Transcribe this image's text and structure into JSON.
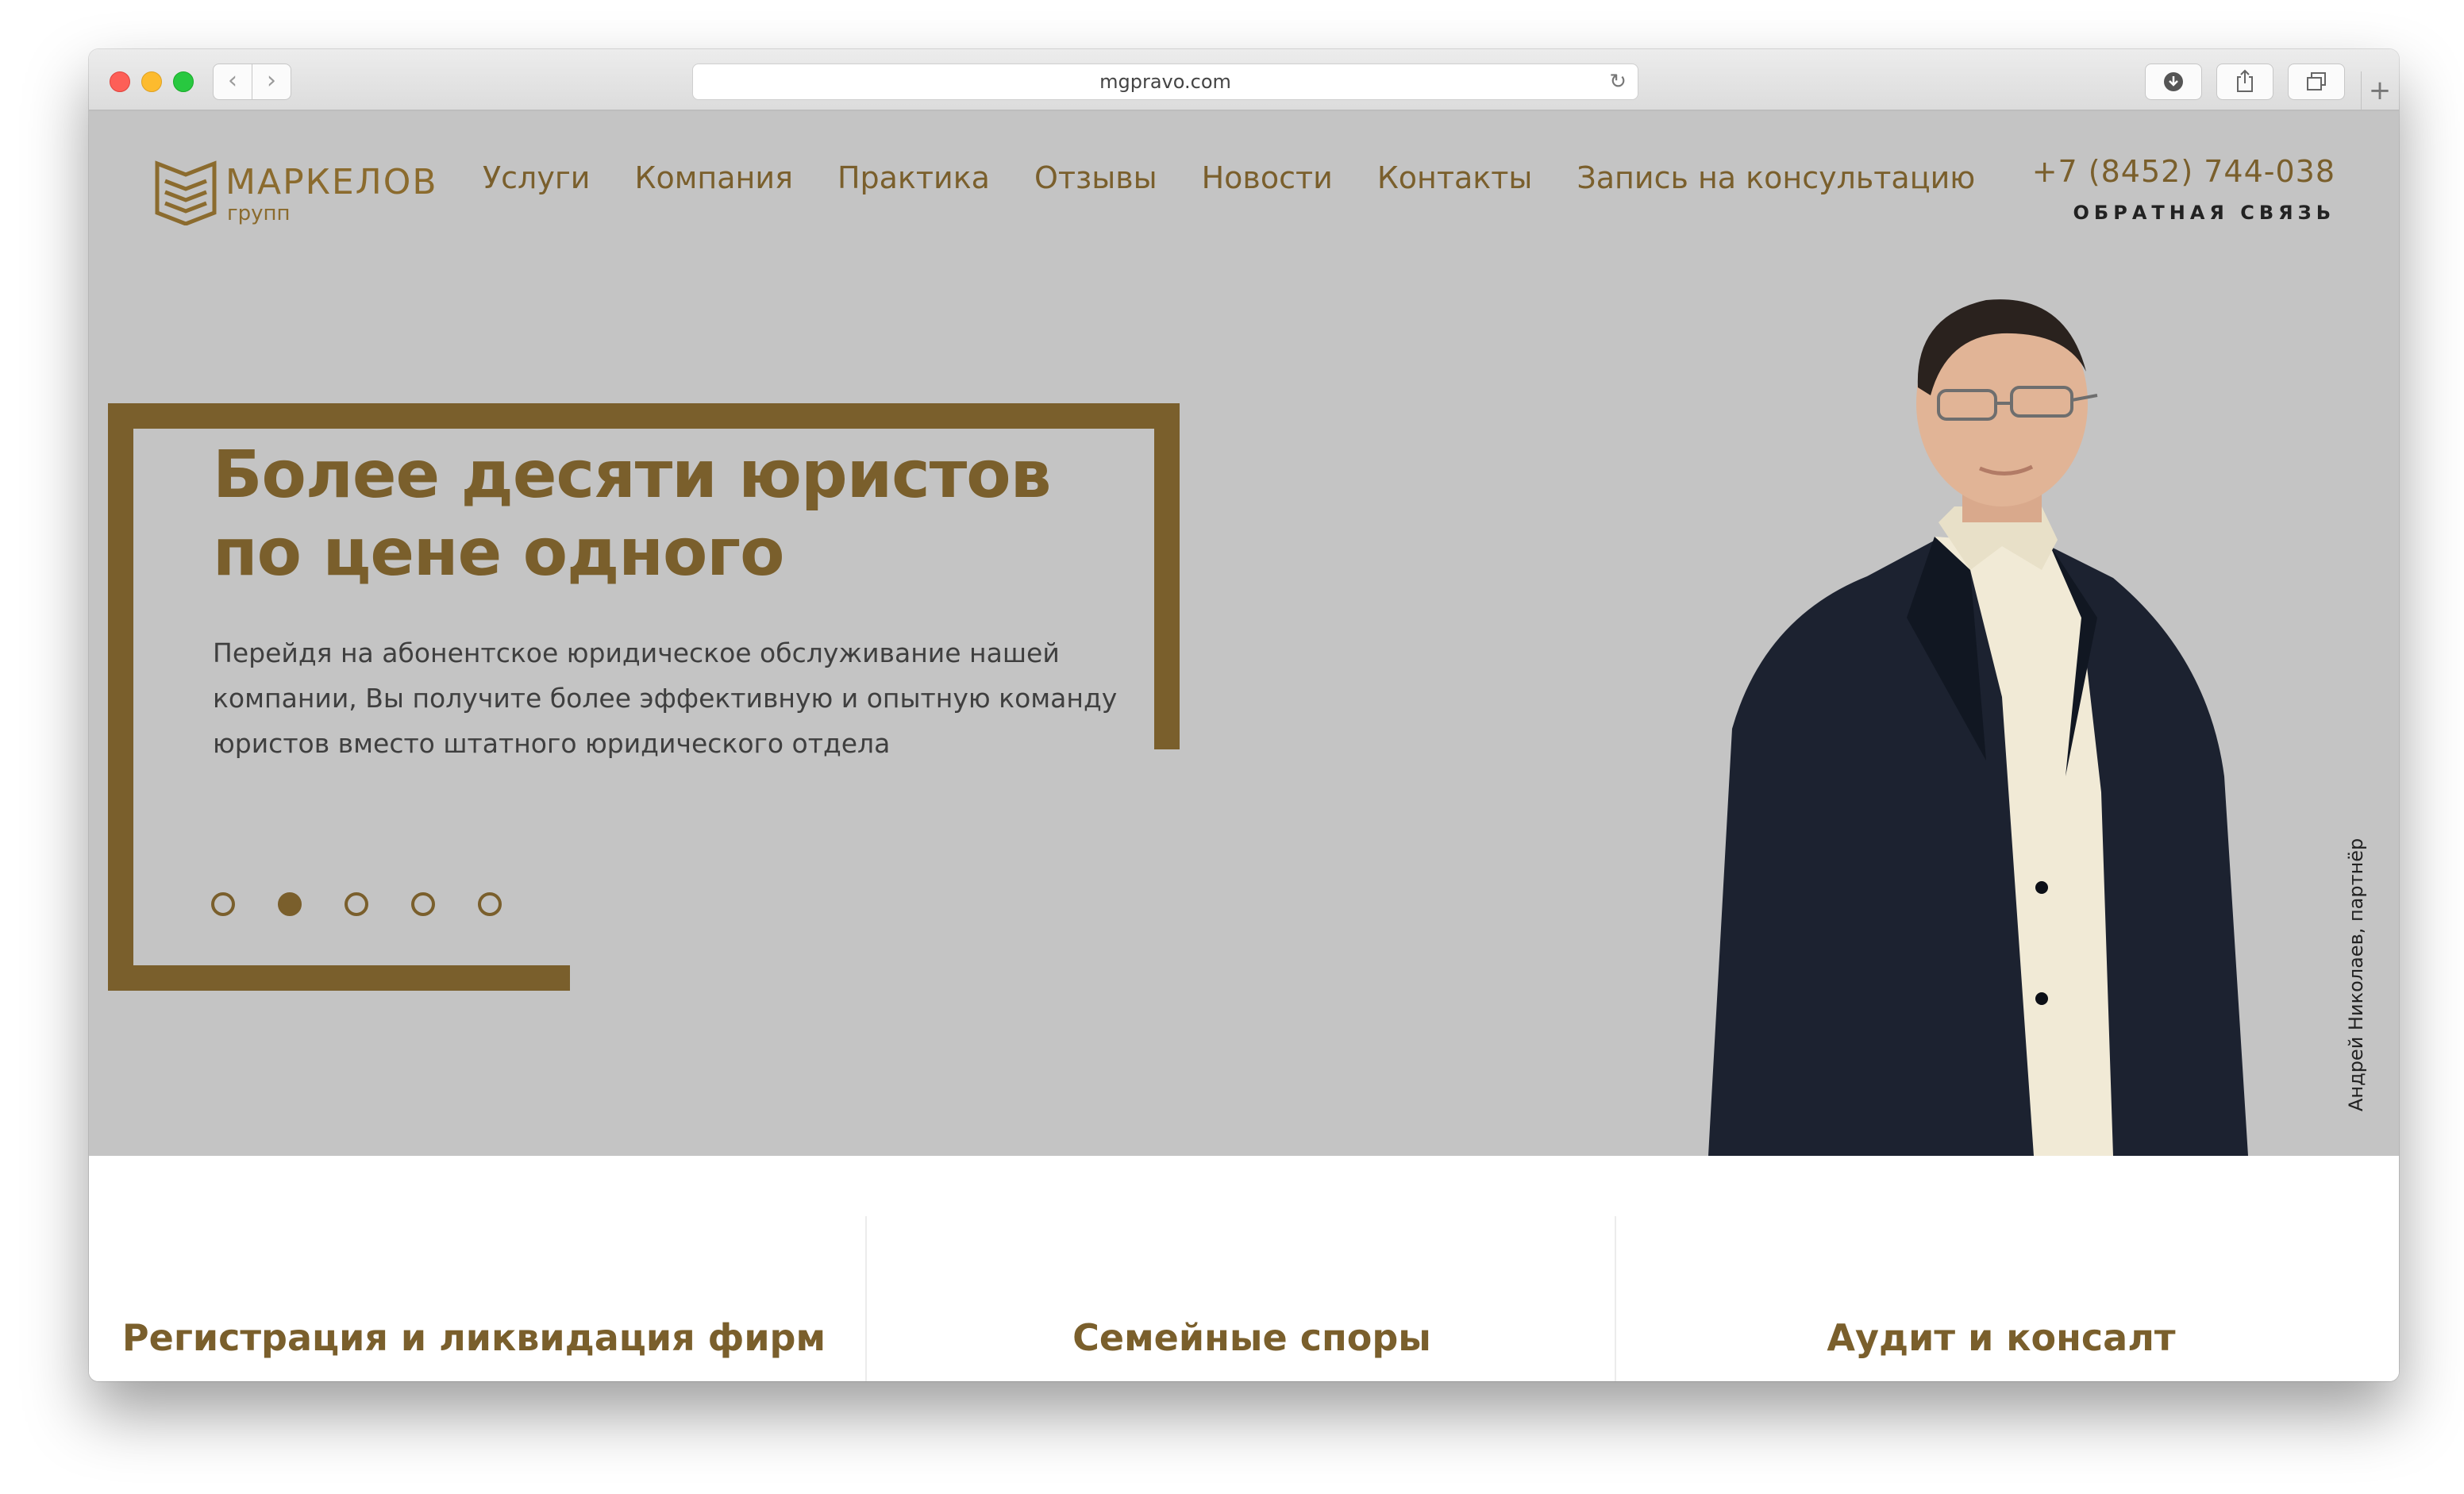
{
  "browser": {
    "url": "mgpravo.com"
  },
  "site": {
    "brand_name": "МАРКЕЛОВ",
    "brand_sub": "групп",
    "nav": [
      "Услуги",
      "Компания",
      "Практика",
      "Отзывы",
      "Новости",
      "Контакты",
      "Запись на консультацию"
    ],
    "phone": "+7 (8452) 744-038",
    "feedback": "ОБРАТНАЯ СВЯЗЬ",
    "accent_color": "#7a5f2c",
    "hero_bg": "#c4c4c4"
  },
  "hero": {
    "headline": "Более десяти юристов по цене одного",
    "subtext": "Перейдя на абонентское юридическое обслуживание нашей компании, Вы получите более эффективную и опытную команду юристов вместо штатного юридического отдела",
    "slides_total": 5,
    "active_slide": 2,
    "person_caption": "Андрей Николаев, партнёр"
  },
  "services": [
    {
      "title": "Регистрация и ликвидация фирм"
    },
    {
      "title": "Семейные споры"
    },
    {
      "title": "Аудит и консалт"
    }
  ]
}
